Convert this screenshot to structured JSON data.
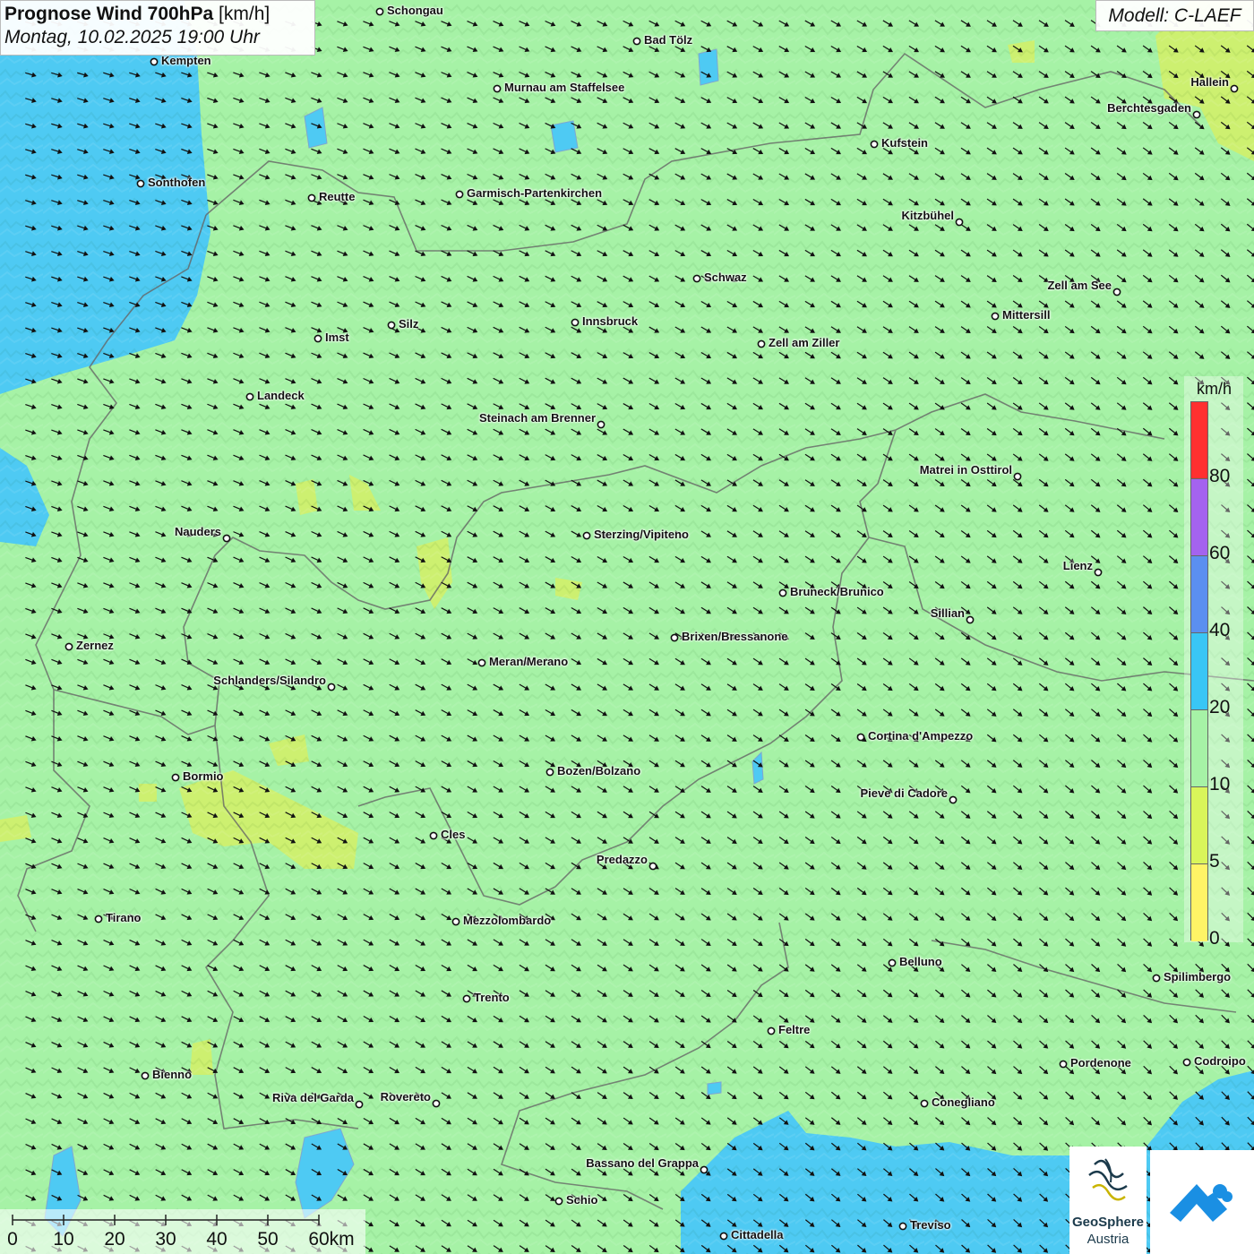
{
  "header": {
    "title_bold": "Prognose Wind 700hPa",
    "title_unit": "[km/h]",
    "subtitle": "Montag, 10.02.2025 19:00 Uhr"
  },
  "model": {
    "label": "Modell: C-LAEF"
  },
  "legend": {
    "unit": "km/h",
    "ticks": [
      "80",
      "60",
      "40",
      "20",
      "10",
      "5",
      "0"
    ],
    "colors": [
      "#ff3030",
      "#a463ef",
      "#5b8ff0",
      "#39c6f5",
      "#a6f2a6",
      "#d9f55a",
      "#fff466"
    ],
    "top_segment_color": "#ff3030"
  },
  "scalebar": {
    "labels": [
      "0",
      "10",
      "20",
      "30",
      "40",
      "50",
      "60km"
    ]
  },
  "logos": {
    "geosphere_line1": "GeoSphere",
    "geosphere_line2": "Austria"
  },
  "wind": {
    "direction": "from west-northwest",
    "dominant_speed_class": "10-20 km/h"
  },
  "cities": [
    "Schongau",
    "Bad Tölz",
    "Kempten",
    "Murnau am Staffelsee",
    "Hallein",
    "Berchtesgaden",
    "Kufstein",
    "Sonthofen",
    "Reutte",
    "Garmisch-Partenkirchen",
    "Kitzbühel",
    "Schwaz",
    "Zell am See",
    "Mittersill",
    "Innsbruck",
    "Silz",
    "Imst",
    "Zell am Ziller",
    "Landeck",
    "Steinach am Brenner",
    "Matrei in Osttirol",
    "Nauders",
    "Sterzing/Vipiteno",
    "Lienz",
    "Bruneck/Brunico",
    "Sillian",
    "Brixen/Bressanone",
    "Zernez",
    "Meran/Merano",
    "Schlanders/Silandro",
    "Cortina d'Ampezzo",
    "Bozen/Bolzano",
    "Bormio",
    "Pieve di Cadore",
    "Cles",
    "Predazzo",
    "Tirano",
    "Mezzolombardo",
    "Belluno",
    "Spilimbergo",
    "Trento",
    "Feltre",
    "Bienno",
    "Pordenone",
    "Codroipo",
    "Riva del Garda",
    "Rovereto",
    "Conegliano",
    "Bassano del Grappa",
    "Schio",
    "Treviso",
    "Cittadella"
  ]
}
